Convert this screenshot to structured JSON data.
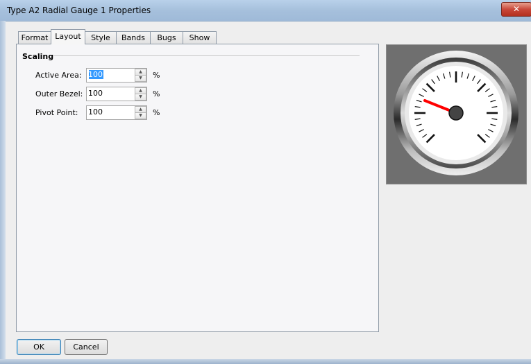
{
  "window": {
    "title": "Type A2 Radial Gauge 1 Properties",
    "close_glyph": "✕"
  },
  "tabs": [
    {
      "label": "Format"
    },
    {
      "label": "Layout",
      "active": true
    },
    {
      "label": "Style"
    },
    {
      "label": "Bands"
    },
    {
      "label": "Bugs"
    },
    {
      "label": "Show"
    }
  ],
  "scaling": {
    "group_title": "Scaling",
    "fields": [
      {
        "label": "Active Area:",
        "value": "100",
        "unit": "%"
      },
      {
        "label": "Outer Bezel:",
        "value": "100",
        "unit": "%"
      },
      {
        "label": "Pivot Point:",
        "value": "100",
        "unit": "%"
      }
    ]
  },
  "preview": {
    "needle_color": "#ff0000",
    "pivot_color": "#444444",
    "face_color": "#ffffff",
    "background_color": "#6f6f6f"
  },
  "footer": {
    "ok_label": "OK",
    "cancel_label": "Cancel"
  }
}
